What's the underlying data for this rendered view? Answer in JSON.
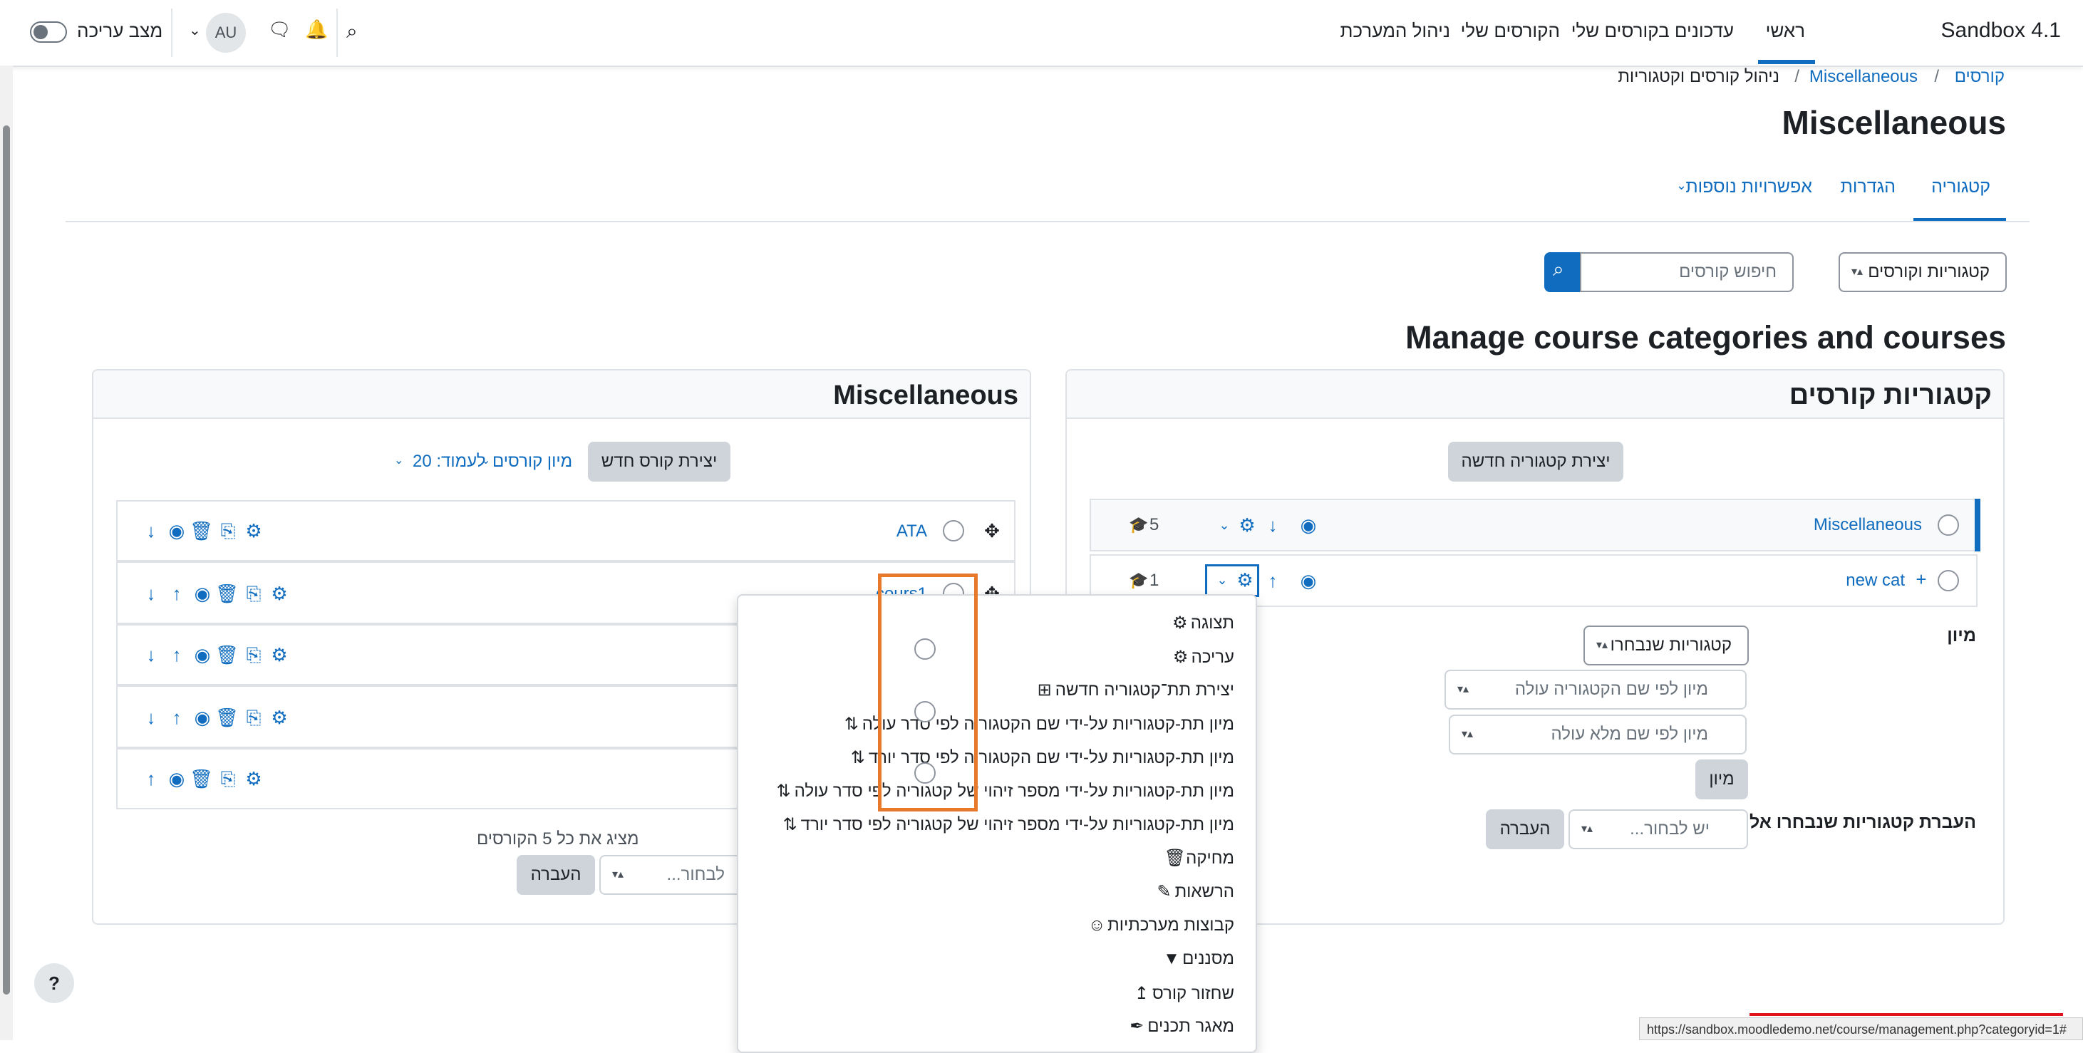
{
  "navbar": {
    "brand": "Sandbox 4.1",
    "items": [
      "ראשי",
      "עדכונים בקורסים שלי",
      "הקורסים שלי",
      "ניהול המערכת"
    ],
    "avatar": "AU",
    "edit_mode_label": "מצב עריכה",
    "icons": [
      "search-icon",
      "bell-icon",
      "chat-icon",
      "chevron-down-icon"
    ]
  },
  "breadcrumb": [
    "קורסים",
    "/",
    "Miscellaneous",
    "/",
    "ניהול קורסים וקטגוריות"
  ],
  "page_title": "Miscellaneous",
  "tabs": [
    "קטגוריה",
    "הגדרות",
    "אפשרויות נוספות"
  ],
  "toolbar": {
    "view_select": "קטגוריות וקורסים",
    "search_placeholder": "חיפוש קורסים"
  },
  "heading": "Manage course categories and courses",
  "categories_panel": {
    "title": "קטגוריות קורסים",
    "create_button": "יצירת קטגוריה חדשה",
    "rows": [
      {
        "name": "Miscellaneous",
        "count": "5"
      },
      {
        "name": "new cat",
        "count": "1"
      }
    ],
    "sort_label": "מיון",
    "sort_select_1": "קטגוריות שנבחרו",
    "sort_select_2": "מיון לפי שם הקטגוריה עולה",
    "sort_select_3": "מיון לפי שם מלא עולה",
    "sort_button": "מיון",
    "move_label": "העברת קטגוריות שנבחרו אל",
    "move_select": "יש לבחור...",
    "move_button": "העברה"
  },
  "courses_panel": {
    "title": "Miscellaneous",
    "create_button": "יצירת קורס חדש",
    "sort_link": "מיון קורסים",
    "per_page": "לעמוד: 20",
    "rows": [
      "ATA",
      "cours1",
      "",
      "",
      ""
    ],
    "showing": "מציג את כל 5 הקורסים",
    "move_select": "לבחור...",
    "move_button": "העברה"
  },
  "dropdown_menu": {
    "items": [
      {
        "label": "תצוגה",
        "icon": "gear-icon"
      },
      {
        "label": "עריכה",
        "icon": "gear-icon"
      },
      {
        "label": "יצירת תת־קטגוריה חדשה",
        "icon": "plus-square-icon"
      },
      {
        "label": "מיון תת-קטגוריות על-ידי שם הקטגוריה לפי סדר עולה",
        "icon": "sort-icon"
      },
      {
        "label": "מיון תת-קטגוריות על-ידי שם הקטגוריה לפי סדר יורד",
        "icon": "sort-icon"
      },
      {
        "label": "מיון תת-קטגוריות על-ידי מספר זיהוי של קטגוריה לפי סדר עולה",
        "icon": "sort-icon"
      },
      {
        "label": "מיון תת-קטגוריות על-ידי מספר זיהוי של קטגוריה לפי סדר יורד",
        "icon": "sort-icon"
      },
      {
        "label": "מחיקה",
        "icon": "trash-icon"
      },
      {
        "label": "הרשאות",
        "icon": "edit-icon"
      },
      {
        "label": "קבוצות מערכתיות",
        "icon": "users-icon"
      },
      {
        "label": "מסננים",
        "icon": "filter-icon"
      },
      {
        "label": "שחזור קורס",
        "icon": "restore-icon"
      },
      {
        "label": "מאגר תכנים",
        "icon": "paint-brush-icon"
      }
    ]
  },
  "help_button": "?",
  "status_url": "https://sandbox.moodledemo.net/course/management.php?categoryid=1#"
}
